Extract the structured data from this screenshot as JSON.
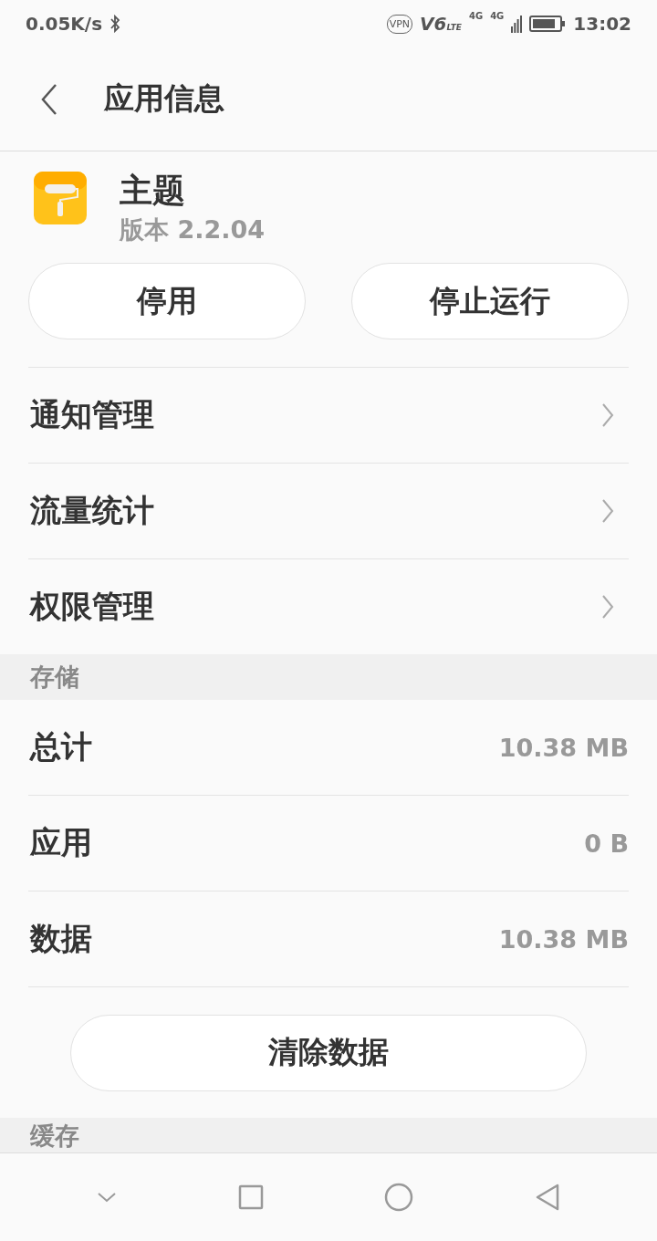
{
  "status_bar": {
    "speed": "0.05K/s",
    "vpn": "VPN",
    "volte": "V6",
    "lte": "LTE",
    "sim1": "4G",
    "sim2": "4G",
    "time": "13:02"
  },
  "header": {
    "title": "应用信息"
  },
  "app": {
    "name": "主题",
    "version": "版本 2.2.04"
  },
  "actions": [
    "停用",
    "停止运行"
  ],
  "menu": [
    {
      "label": "通知管理"
    },
    {
      "label": "流量统计"
    },
    {
      "label": "权限管理"
    }
  ],
  "storage": {
    "title": "存储",
    "rows": [
      {
        "label": "总计",
        "value": "10.38 MB"
      },
      {
        "label": "应用",
        "value": "0 B"
      },
      {
        "label": "数据",
        "value": "10.38 MB"
      }
    ],
    "button": "清除数据"
  },
  "cache": {
    "title": "缓存"
  }
}
